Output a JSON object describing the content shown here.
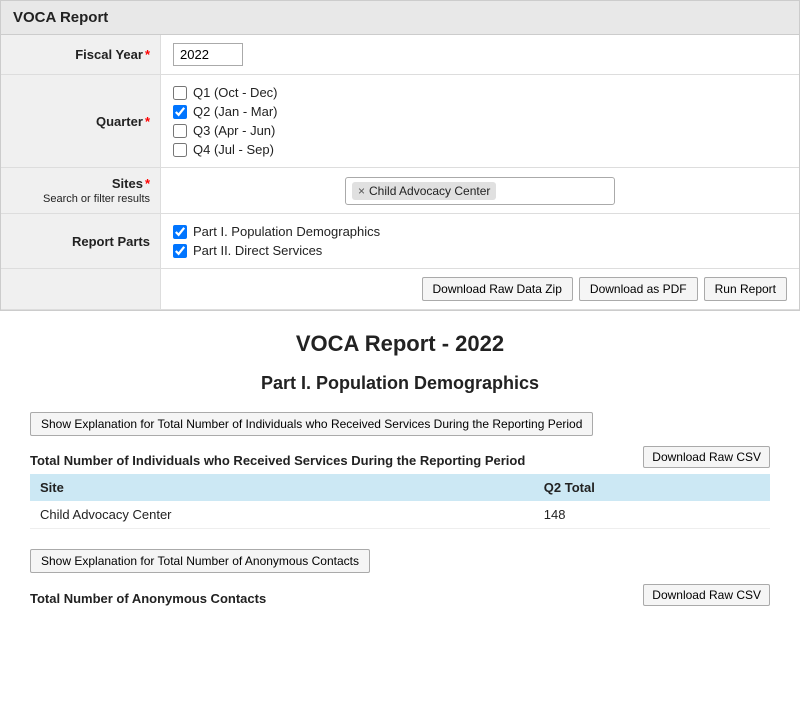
{
  "header": {
    "title": "VOCA Report"
  },
  "form": {
    "fiscal_year_label": "Fiscal Year",
    "fiscal_year_value": "2022",
    "quarter_label": "Quarter",
    "quarters": [
      {
        "id": "q1",
        "label": "Q1 (Oct - Dec)",
        "checked": false
      },
      {
        "id": "q2",
        "label": "Q2 (Jan - Mar)",
        "checked": true
      },
      {
        "id": "q3",
        "label": "Q3 (Apr - Jun)",
        "checked": false
      },
      {
        "id": "q4",
        "label": "Q4 (Jul - Sep)",
        "checked": false
      }
    ],
    "sites_label": "Sites",
    "sites_sublabel": "Search or filter results",
    "sites_tag": "Child Advocacy Center",
    "report_parts_label": "Report Parts",
    "report_parts": [
      {
        "id": "part1",
        "label": "Part I. Population Demographics",
        "checked": true
      },
      {
        "id": "part2",
        "label": "Part II. Direct Services",
        "checked": true
      }
    ],
    "buttons": {
      "download_raw_zip": "Download Raw Data Zip",
      "download_pdf": "Download as PDF",
      "run_report": "Run Report"
    }
  },
  "report": {
    "main_title": "VOCA Report - 2022",
    "section1_title": "Part I. Population Demographics",
    "explanation_btn1": "Show Explanation for Total Number of Individuals who Received Services During the Reporting Period",
    "table1": {
      "label": "Total Number of Individuals who Received Services During the Reporting Period",
      "download_btn": "Download Raw CSV",
      "columns": [
        "Site",
        "Q2 Total"
      ],
      "rows": [
        {
          "site": "Child Advocacy Center",
          "value": "148"
        }
      ]
    },
    "explanation_btn2": "Show Explanation for Total Number of Anonymous Contacts",
    "table2": {
      "label": "Total Number of Anonymous Contacts",
      "download_btn": "Download Raw CSV"
    }
  }
}
